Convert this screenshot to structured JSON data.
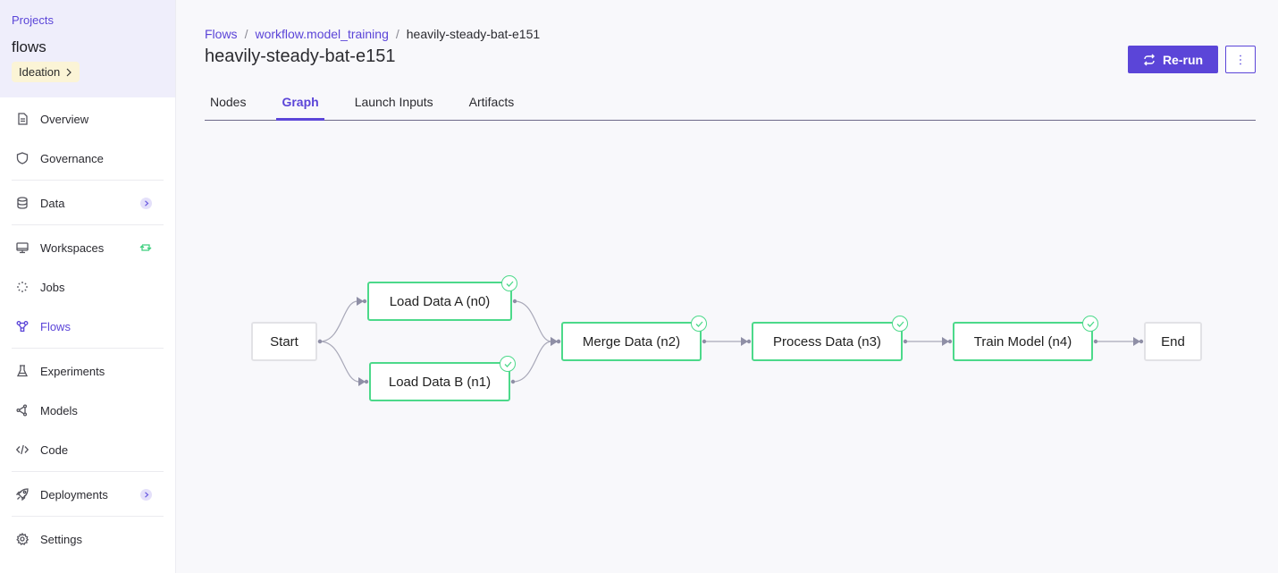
{
  "sidebar": {
    "projects_link": "Projects",
    "project_name": "flows",
    "stage_badge": "Ideation",
    "items": [
      {
        "label": "Overview",
        "icon": "document-icon"
      },
      {
        "label": "Governance",
        "icon": "shield-icon"
      },
      {
        "label": "Data",
        "icon": "database-icon",
        "trail": "chevron-right-icon"
      },
      {
        "label": "Workspaces",
        "icon": "monitor-icon",
        "trail": "sync-icon"
      },
      {
        "label": "Jobs",
        "icon": "spinner-icon"
      },
      {
        "label": "Flows",
        "icon": "flows-icon",
        "active": true
      },
      {
        "label": "Experiments",
        "icon": "flask-icon"
      },
      {
        "label": "Models",
        "icon": "model-icon"
      },
      {
        "label": "Code",
        "icon": "code-icon"
      },
      {
        "label": "Deployments",
        "icon": "rocket-icon",
        "trail": "chevron-right-icon"
      },
      {
        "label": "Settings",
        "icon": "gear-icon"
      }
    ]
  },
  "breadcrumb": {
    "items": [
      "Flows",
      "workflow.model_training"
    ],
    "separator": "/",
    "current": "heavily-steady-bat-e151"
  },
  "header": {
    "title": "heavily-steady-bat-e151",
    "rerun_label": "Re-run"
  },
  "tabs": [
    {
      "label": "Nodes"
    },
    {
      "label": "Graph",
      "active": true
    },
    {
      "label": "Launch Inputs"
    },
    {
      "label": "Artifacts"
    }
  ],
  "graph": {
    "nodes": [
      {
        "id": "start",
        "label": "Start",
        "status": "none"
      },
      {
        "id": "n0",
        "label": "Load Data A (n0)",
        "status": "succeeded"
      },
      {
        "id": "n1",
        "label": "Load Data B (n1)",
        "status": "succeeded"
      },
      {
        "id": "n2",
        "label": "Merge Data (n2)",
        "status": "succeeded"
      },
      {
        "id": "n3",
        "label": "Process Data (n3)",
        "status": "succeeded"
      },
      {
        "id": "n4",
        "label": "Train Model (n4)",
        "status": "succeeded"
      },
      {
        "id": "end",
        "label": "End",
        "status": "none"
      }
    ],
    "edges": [
      [
        "start",
        "n0"
      ],
      [
        "start",
        "n1"
      ],
      [
        "n0",
        "n2"
      ],
      [
        "n1",
        "n2"
      ],
      [
        "n2",
        "n3"
      ],
      [
        "n3",
        "n4"
      ],
      [
        "n4",
        "end"
      ]
    ],
    "colors": {
      "success": "#4cd98a",
      "accent": "#5b45d8",
      "edge": "#a8a8b8"
    }
  }
}
